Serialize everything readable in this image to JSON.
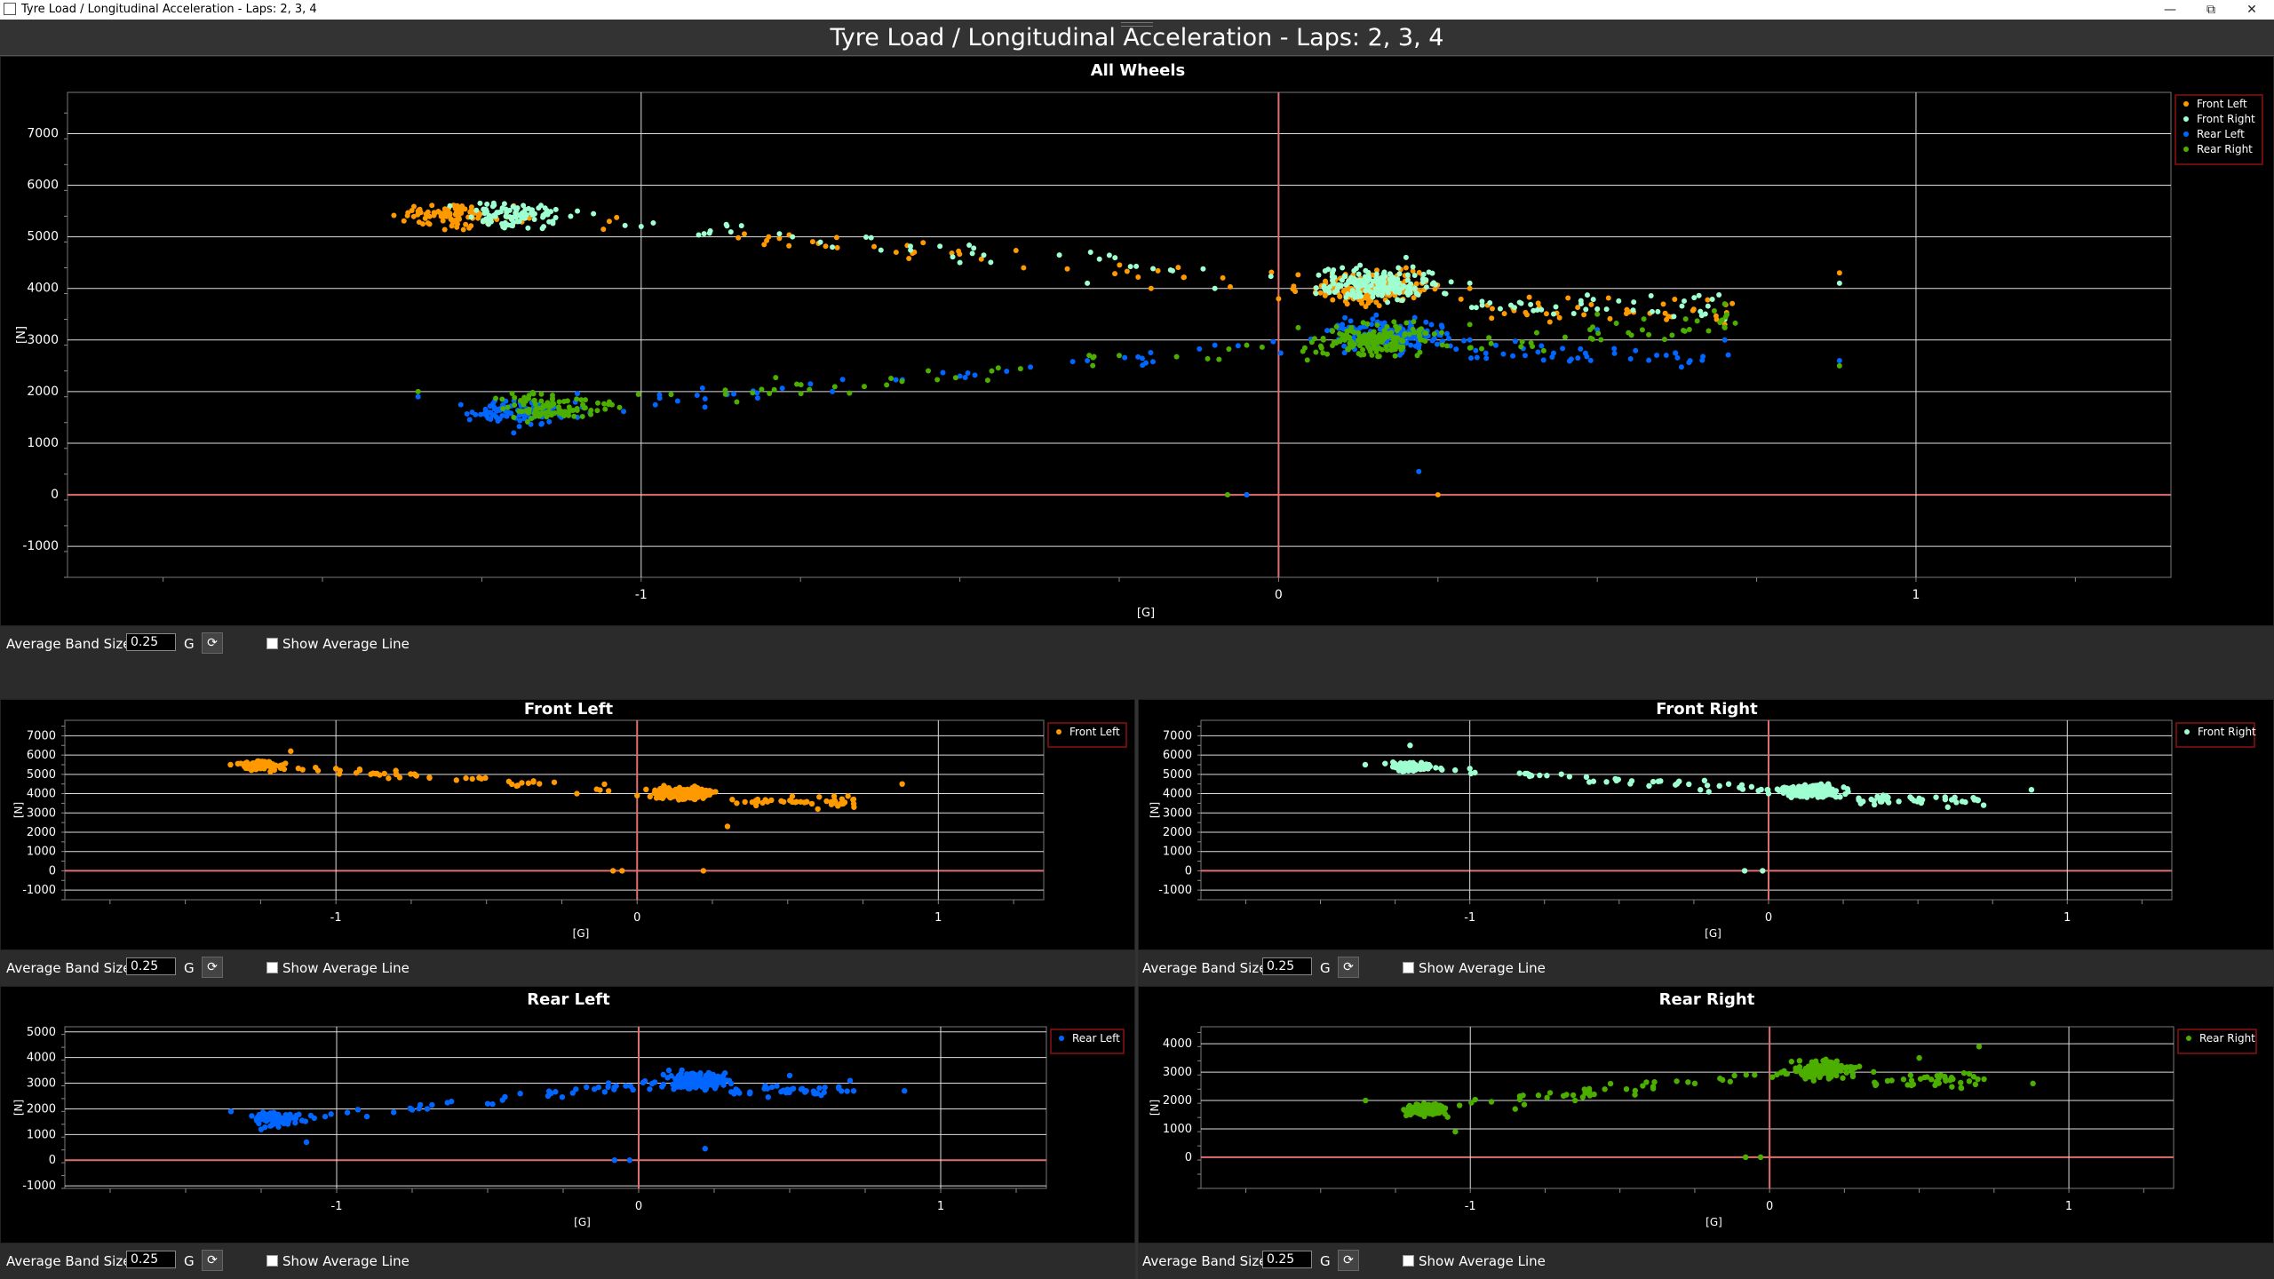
{
  "window": {
    "title": "Tyre Load / Longitudinal Acceleration  - Laps: 2, 3, 4",
    "minimize_icon": "minimize-icon",
    "maximize_icon": "restore-icon",
    "close_icon": "close-icon"
  },
  "header": {
    "title": "Tyre Load / Longitudinal Acceleration  - Laps: 2, 3, 4"
  },
  "controls": {
    "band_label": "Average Band Size:",
    "band_value": "0.25",
    "unit": "G",
    "reset_icon": "refresh-icon",
    "show_avg_label": "Show Average Line"
  },
  "colors": {
    "front_left": "#ff9900",
    "front_right": "#9effd0",
    "rear_left": "#0066ff",
    "rear_right": "#4caf00",
    "zero_line": "#e07070",
    "grid": "#ffffff",
    "background": "#000000"
  },
  "chart_data": [
    {
      "type": "scatter",
      "title": "All Wheels",
      "xlabel": "[G]",
      "ylabel": "[N]",
      "xlim": [
        -1.9,
        1.4
      ],
      "ylim": [
        -1600,
        7800
      ],
      "xticks": [
        -1,
        0,
        1
      ],
      "yticks": [
        -1000,
        0,
        1000,
        2000,
        3000,
        4000,
        5000,
        6000,
        7000
      ],
      "grid": true,
      "legend": "top-right",
      "series": [
        {
          "name": "Front Left",
          "color": "#ff9900",
          "cluster_start": [
            -1.3,
            5450
          ],
          "cluster_main": [
            0.15,
            4000
          ],
          "points": [
            [
              -1.35,
              5500
            ],
            [
              -1.2,
              5600
            ],
            [
              -1.05,
              5300
            ],
            [
              -0.8,
              5000
            ],
            [
              -0.6,
              4700
            ],
            [
              -0.4,
              4400
            ],
            [
              -0.2,
              4000
            ],
            [
              0.0,
              3800
            ],
            [
              0.1,
              4200
            ],
            [
              0.2,
              4400
            ],
            [
              0.3,
              4000
            ],
            [
              0.5,
              3600
            ],
            [
              0.7,
              3300
            ],
            [
              0.88,
              4300
            ],
            [
              0.25,
              0
            ],
            [
              -0.08,
              0
            ]
          ]
        },
        {
          "name": "Front Right",
          "color": "#9effd0",
          "cluster_start": [
            -1.2,
            5400
          ],
          "cluster_main": [
            0.15,
            4100
          ],
          "points": [
            [
              -1.3,
              5600
            ],
            [
              -1.1,
              5500
            ],
            [
              -1.0,
              5200
            ],
            [
              -0.7,
              4800
            ],
            [
              -0.5,
              4500
            ],
            [
              -0.3,
              4100
            ],
            [
              -0.1,
              4000
            ],
            [
              0.1,
              4400
            ],
            [
              0.2,
              4600
            ],
            [
              0.3,
              4100
            ],
            [
              0.5,
              3600
            ],
            [
              0.7,
              3400
            ],
            [
              0.88,
              4100
            ],
            [
              -0.05,
              0
            ]
          ]
        },
        {
          "name": "Rear Left",
          "color": "#0066ff",
          "cluster_start": [
            -1.2,
            1600
          ],
          "cluster_main": [
            0.18,
            3100
          ],
          "points": [
            [
              -1.35,
              1900
            ],
            [
              -1.2,
              1200
            ],
            [
              -1.1,
              1500
            ],
            [
              -0.9,
              1700
            ],
            [
              -0.7,
              2000
            ],
            [
              -0.5,
              2300
            ],
            [
              -0.3,
              2600
            ],
            [
              -0.1,
              2900
            ],
            [
              0.1,
              3300
            ],
            [
              0.3,
              3000
            ],
            [
              0.5,
              3200
            ],
            [
              0.7,
              3000
            ],
            [
              0.88,
              2600
            ],
            [
              0.22,
              450
            ],
            [
              -0.05,
              0
            ]
          ]
        },
        {
          "name": "Rear Right",
          "color": "#4caf00",
          "cluster_start": [
            -1.15,
            1700
          ],
          "cluster_main": [
            0.15,
            3000
          ],
          "points": [
            [
              -1.35,
              2000
            ],
            [
              -1.2,
              1500
            ],
            [
              -1.05,
              1800
            ],
            [
              -0.85,
              1800
            ],
            [
              -0.65,
              2100
            ],
            [
              -0.45,
              2400
            ],
            [
              -0.25,
              2700
            ],
            [
              -0.05,
              2900
            ],
            [
              0.1,
              3100
            ],
            [
              0.3,
              3300
            ],
            [
              0.5,
              3500
            ],
            [
              0.7,
              3700
            ],
            [
              0.88,
              2500
            ],
            [
              -0.08,
              0
            ]
          ]
        }
      ]
    },
    {
      "type": "scatter",
      "title": "Front Left",
      "xlabel": "[G]",
      "ylabel": "[N]",
      "xlim": [
        -1.9,
        1.35
      ],
      "ylim": [
        -1500,
        7800
      ],
      "xticks": [
        -1,
        0,
        1
      ],
      "yticks": [
        -1000,
        0,
        1000,
        2000,
        3000,
        4000,
        5000,
        6000,
        7000
      ],
      "grid": true,
      "legend": "top-right",
      "series": [
        {
          "name": "Front Left",
          "color": "#ff9900",
          "cluster_start": [
            -1.25,
            5450
          ],
          "cluster_main": [
            0.15,
            4000
          ],
          "points": [
            [
              -1.35,
              5500
            ],
            [
              -1.15,
              6200
            ],
            [
              -1.0,
              5300
            ],
            [
              -0.8,
              5000
            ],
            [
              -0.6,
              4700
            ],
            [
              -0.4,
              4400
            ],
            [
              -0.2,
              4000
            ],
            [
              0.0,
              3900
            ],
            [
              0.2,
              4300
            ],
            [
              0.4,
              3700
            ],
            [
              0.6,
              3200
            ],
            [
              0.72,
              3300
            ],
            [
              0.88,
              4500
            ],
            [
              0.22,
              0
            ],
            [
              -0.05,
              0
            ],
            [
              -0.08,
              0
            ],
            [
              0.3,
              2300
            ]
          ]
        }
      ]
    },
    {
      "type": "scatter",
      "title": "Front Right",
      "xlabel": "[G]",
      "ylabel": "[N]",
      "xlim": [
        -1.9,
        1.35
      ],
      "ylim": [
        -1500,
        7800
      ],
      "xticks": [
        -1,
        0,
        1
      ],
      "yticks": [
        -1000,
        0,
        1000,
        2000,
        3000,
        4000,
        5000,
        6000,
        7000
      ],
      "grid": true,
      "legend": "top-right",
      "series": [
        {
          "name": "Front Right",
          "color": "#9effd0",
          "cluster_start": [
            -1.2,
            5400
          ],
          "cluster_main": [
            0.15,
            4100
          ],
          "points": [
            [
              -1.35,
              5500
            ],
            [
              -1.2,
              6500
            ],
            [
              -1.0,
              5300
            ],
            [
              -0.8,
              4900
            ],
            [
              -0.6,
              4600
            ],
            [
              -0.4,
              4400
            ],
            [
              -0.2,
              4100
            ],
            [
              0.0,
              4000
            ],
            [
              0.2,
              4500
            ],
            [
              0.4,
              3800
            ],
            [
              0.6,
              3300
            ],
            [
              0.72,
              3400
            ],
            [
              0.88,
              4200
            ],
            [
              -0.08,
              0
            ],
            [
              -0.02,
              0
            ]
          ]
        }
      ]
    },
    {
      "type": "scatter",
      "title": "Rear Left",
      "xlabel": "[G]",
      "ylabel": "[N]",
      "xlim": [
        -1.9,
        1.35
      ],
      "ylim": [
        -1100,
        5200
      ],
      "xticks": [
        -1,
        0,
        1
      ],
      "yticks": [
        -1000,
        0,
        1000,
        2000,
        3000,
        4000,
        5000
      ],
      "grid": true,
      "legend": "top-right",
      "series": [
        {
          "name": "Rear Left",
          "color": "#0066ff",
          "cluster_start": [
            -1.2,
            1600
          ],
          "cluster_main": [
            0.18,
            3100
          ],
          "points": [
            [
              -1.35,
              1900
            ],
            [
              -1.25,
              1200
            ],
            [
              -1.1,
              700
            ],
            [
              -0.9,
              1700
            ],
            [
              -0.7,
              2000
            ],
            [
              -0.5,
              2200
            ],
            [
              -0.3,
              2500
            ],
            [
              -0.1,
              3000
            ],
            [
              0.1,
              3500
            ],
            [
              0.3,
              3100
            ],
            [
              0.5,
              3300
            ],
            [
              0.7,
              3100
            ],
            [
              0.88,
              2700
            ],
            [
              0.22,
              450
            ],
            [
              -0.08,
              0
            ],
            [
              -0.03,
              0
            ]
          ]
        }
      ]
    },
    {
      "type": "scatter",
      "title": "Rear Right",
      "xlabel": "[G]",
      "ylabel": "[N]",
      "xlim": [
        -1.9,
        1.35
      ],
      "ylim": [
        -1100,
        4600
      ],
      "xticks": [
        -1,
        0,
        1
      ],
      "yticks": [
        0,
        1000,
        2000,
        3000,
        4000
      ],
      "grid": true,
      "legend": "top-right",
      "series": [
        {
          "name": "Rear Right",
          "color": "#4caf00",
          "cluster_start": [
            -1.15,
            1700
          ],
          "cluster_main": [
            0.18,
            3100
          ],
          "points": [
            [
              -1.35,
              2000
            ],
            [
              -1.2,
              1500
            ],
            [
              -1.05,
              900
            ],
            [
              -0.85,
              1700
            ],
            [
              -0.65,
              2000
            ],
            [
              -0.45,
              2200
            ],
            [
              -0.25,
              2600
            ],
            [
              -0.05,
              2900
            ],
            [
              0.1,
              3400
            ],
            [
              0.3,
              3200
            ],
            [
              0.5,
              3500
            ],
            [
              0.7,
              3900
            ],
            [
              0.88,
              2600
            ],
            [
              -0.08,
              0
            ],
            [
              -0.03,
              0
            ]
          ]
        }
      ]
    }
  ]
}
